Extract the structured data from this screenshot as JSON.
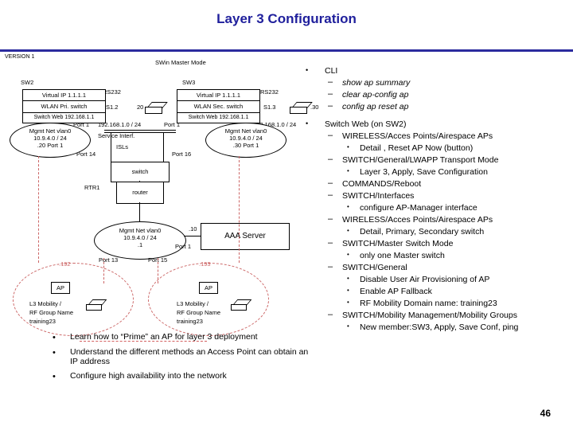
{
  "slide": {
    "title": "Layer 3 Configuration",
    "version": "VERSION 1",
    "page_number": "46"
  },
  "diagram": {
    "labels": {
      "swin_master_mode": "SWin Master Mode",
      "sw2": "SW2",
      "sw3": "SW3",
      "rs232_left": "RS232",
      "rs232_right": "RS232",
      "virtual_ip_left": "Virtual IP 1.1.1.1",
      "virtual_ip_right": "Virtual IP 1.1.1.1",
      "wlan_pri": "WLAN Pri. switch",
      "wlan_sec": "WLAN Sec. switch",
      "s1_2": "S1.2",
      "s1_3": "S1.3",
      "twenty": "20",
      "thirty": ".30",
      "switch_web_left": "Switch Web 192.168.1.1",
      "switch_web_right": "Switch Web 192.168.1.1",
      "net_left": "192.168.1.0 / 24",
      "net_right": "192.168.1.0 / 24",
      "service_interf": "Service Interf.",
      "port1_left": "Port 1",
      "port1_right": "Port 1",
      "port14": "Port  14",
      "port16": "Port  16",
      "isls": "ISLs",
      "switch": "switch",
      "rtr1": "RTR1",
      "router": "router",
      "aaa_server": "AAA Server",
      "ten": ".10",
      "one": ".1",
      "port13": "Port 13",
      "port15": "Port 15",
      "port1_aaa": "Port 1",
      "ap_left": "AP",
      "ap_right": "AP",
      "cloud_left_ip": ".192",
      "cloud_right_ip": ".193",
      "mgmt_left": [
        "Mgmt Net vlan0",
        "10.9.4.0 / 24",
        ".20 Port 1"
      ],
      "mgmt_right": [
        "Mgmt Net vlan0",
        "10.9.4.0 / 24",
        ".30 Port 1"
      ],
      "mgmt_center": [
        "Mgmt Net vlan0",
        "10.9.4.0 / 24",
        ".1"
      ],
      "l3_left": [
        "L3 Mobility /",
        "RF Group Name",
        "training23"
      ],
      "l3_right": [
        "L3 Mobility /",
        "RF Group Name",
        "training23"
      ]
    }
  },
  "bottom_bullets": [
    "Learn how to “Prime” an AP for layer 3 deployment",
    "Understand the different methods an Access Point can obtain an IP address",
    "Configure high availability into the network"
  ],
  "right_outline": [
    {
      "level": 1,
      "text": "CLI"
    },
    {
      "level": 2,
      "text": "show ap summary"
    },
    {
      "level": 2,
      "text": "clear ap-config ap"
    },
    {
      "level": 2,
      "text": "config ap reset ap"
    },
    {
      "level": 1,
      "text": "Switch Web (on SW2)",
      "spaced": true
    },
    {
      "level": 2,
      "text": "WIRELESS/Acces Points/Airespace APs"
    },
    {
      "level": 3,
      "text": "Detail , Reset AP Now (button)"
    },
    {
      "level": 2,
      "text": "SWITCH/General/LWAPP Transport Mode"
    },
    {
      "level": 3,
      "text": "Layer 3, Apply, Save Configuration"
    },
    {
      "level": 2,
      "text": "COMMANDS/Reboot"
    },
    {
      "level": 2,
      "text": "SWITCH/Interfaces"
    },
    {
      "level": 3,
      "text": "configure AP-Manager interface"
    },
    {
      "level": 2,
      "text": "WIRELESS/Acces Points/Airespace APs"
    },
    {
      "level": 3,
      "text": "Detail, Primary, Secondary switch"
    },
    {
      "level": 2,
      "text": "SWITCH/Master Switch Mode"
    },
    {
      "level": 3,
      "text": "only one Master switch"
    },
    {
      "level": 2,
      "text": "SWITCH/General"
    },
    {
      "level": 3,
      "text": "Disable User Air Provisioning of AP"
    },
    {
      "level": 3,
      "text": "Enable AP Fallback"
    },
    {
      "level": 3,
      "text": "RF Mobility Domain name: training23"
    },
    {
      "level": 2,
      "text": "SWITCH/Mobility Management/Mobility Groups"
    },
    {
      "level": 3,
      "text": "New member:SW3, Apply, Save Conf, ping"
    }
  ],
  "colors": {
    "title": "#1f1f9c",
    "rule": "#2b2b9e",
    "dash": "#cc6666"
  }
}
